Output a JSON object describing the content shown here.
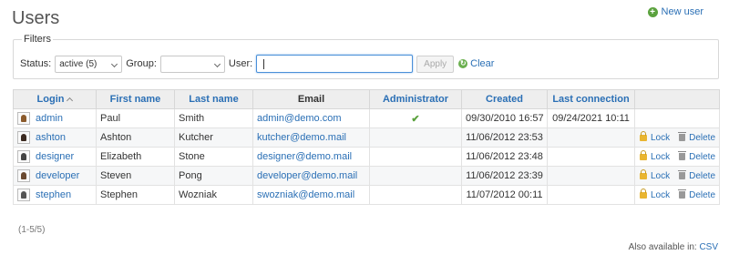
{
  "page": {
    "title": "Users"
  },
  "header": {
    "new_user_label": "New user"
  },
  "filters": {
    "legend": "Filters",
    "status_label": "Status:",
    "status_value": "active (5)",
    "group_label": "Group:",
    "group_value": "",
    "user_label": "User:",
    "user_value": "",
    "apply_label": "Apply",
    "clear_label": "Clear"
  },
  "table": {
    "columns": [
      "Login",
      "First name",
      "Last name",
      "Email",
      "Administrator",
      "Created",
      "Last connection",
      ""
    ],
    "rows": [
      {
        "login": "admin",
        "first": "Paul",
        "last": "Smith",
        "email": "admin@demo.com",
        "admin": true,
        "created": "09/30/2010 16:57",
        "last_conn": "09/24/2021 10:11",
        "lock": "",
        "delete": ""
      },
      {
        "login": "ashton",
        "first": "Ashton",
        "last": "Kutcher",
        "email": "kutcher@demo.mail",
        "admin": false,
        "created": "11/06/2012 23:53",
        "last_conn": "",
        "lock": "Lock",
        "delete": "Delete"
      },
      {
        "login": "designer",
        "first": "Elizabeth",
        "last": "Stone",
        "email": "designer@demo.mail",
        "admin": false,
        "created": "11/06/2012 23:48",
        "last_conn": "",
        "lock": "Lock",
        "delete": "Delete"
      },
      {
        "login": "developer",
        "first": "Steven",
        "last": "Pong",
        "email": "developer@demo.mail",
        "admin": false,
        "created": "11/06/2012 23:39",
        "last_conn": "",
        "lock": "Lock",
        "delete": "Delete"
      },
      {
        "login": "stephen",
        "first": "Stephen",
        "last": "Wozniak",
        "email": "swozniak@demo.mail",
        "admin": false,
        "created": "11/07/2012 00:11",
        "last_conn": "",
        "lock": "Lock",
        "delete": "Delete"
      }
    ]
  },
  "pagination": {
    "text": "(1-5/5)"
  },
  "footer": {
    "also_label": "Also available in:",
    "csv_label": "CSV"
  },
  "colors": {
    "link": "#2a6fb5",
    "success": "#5ba23e",
    "header_bg": "#eeeeee"
  },
  "icons": {
    "new_user": "plus-circle-icon",
    "clear": "refresh-icon",
    "admin_check": "check-icon",
    "lock": "lock-icon",
    "delete": "trash-icon",
    "sort": "sort-asc-icon"
  }
}
